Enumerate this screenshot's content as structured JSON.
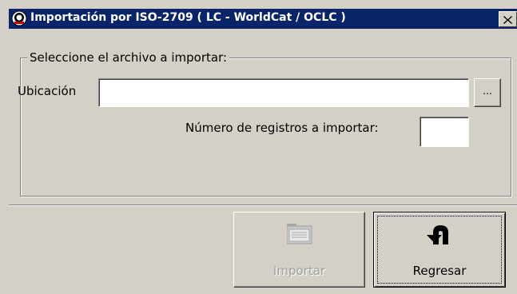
{
  "window": {
    "title": "Importación por ISO-2709  ( LC - WorldCat / OCLC )",
    "title_icon": "app-logo-icon",
    "close_icon": "close-icon"
  },
  "group": {
    "legend": "Seleccione el archivo a importar:",
    "location_label": "Ubicación",
    "location_value": "",
    "browse_label": "...",
    "count_label": "Número de registros a importar:",
    "count_value": ""
  },
  "buttons": {
    "import_label": "Importar",
    "import_icon": "import-document-icon",
    "import_enabled": false,
    "back_label": "Regresar",
    "back_icon": "undo-arrow-icon"
  },
  "colors": {
    "titlebar": "#0a246a",
    "window": "#d4d0c8",
    "disabled_text": "#a0a0a0"
  }
}
